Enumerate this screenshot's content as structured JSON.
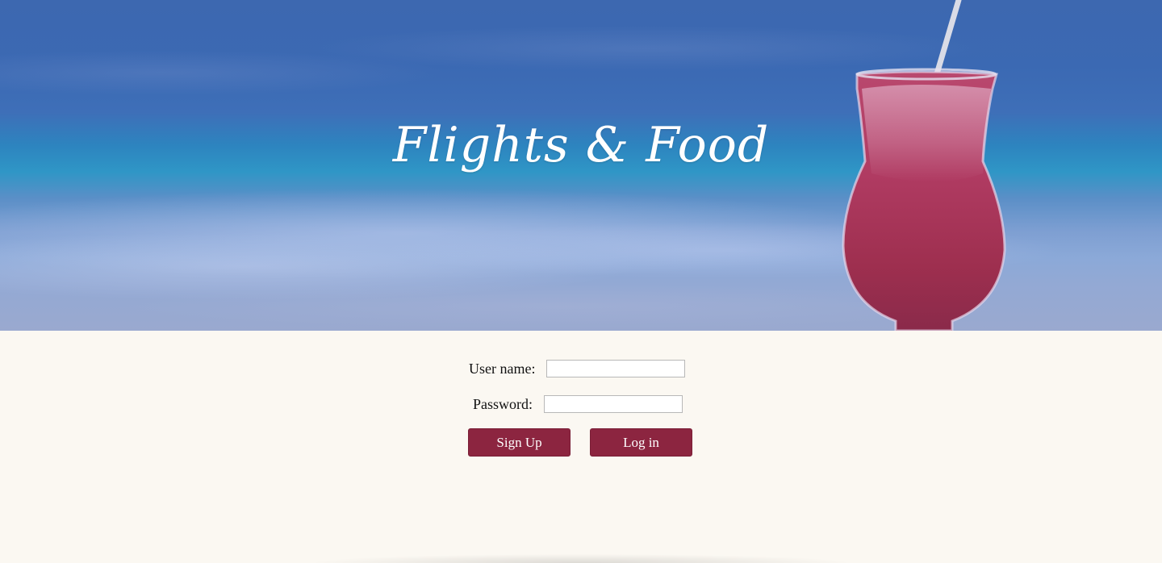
{
  "hero": {
    "title": "Flights & Food"
  },
  "login_form": {
    "username_label": "User name:",
    "username_value": "",
    "password_label": "Password:",
    "password_value": "",
    "signup_label": "Sign Up",
    "login_label": "Log in"
  },
  "colors": {
    "accent": "#8c2540",
    "page_background": "#fbf8f2",
    "title_text": "#ffffff"
  }
}
